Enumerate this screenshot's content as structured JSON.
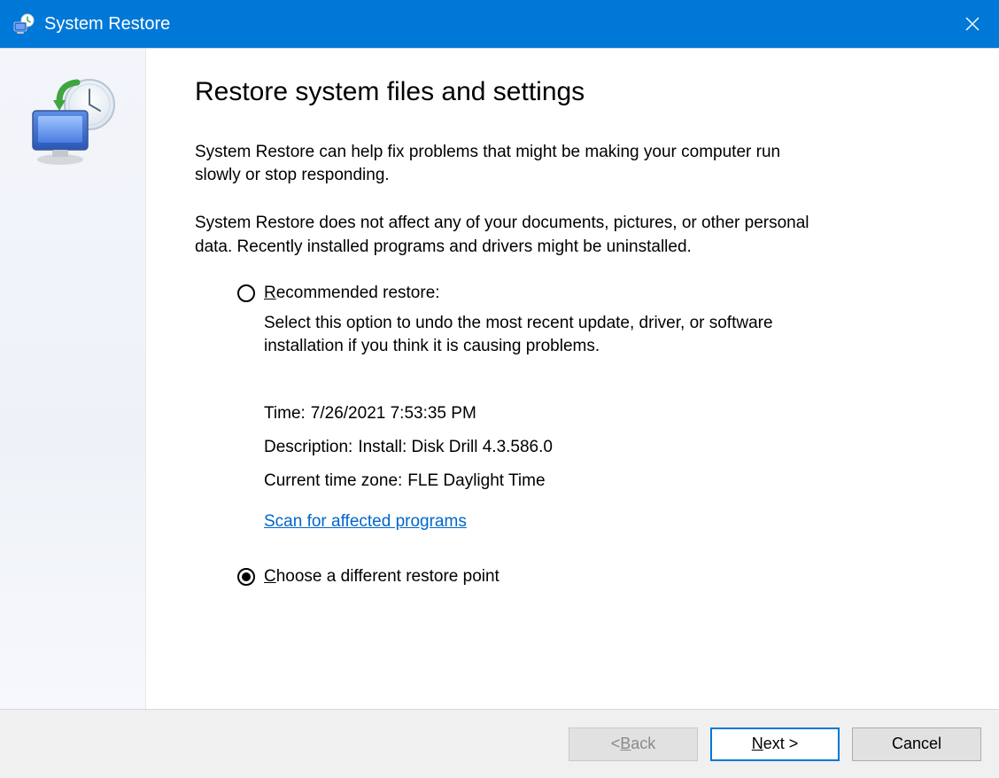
{
  "window": {
    "title": "System Restore"
  },
  "main": {
    "heading": "Restore system files and settings",
    "paragraph1": "System Restore can help fix problems that might be making your computer run slowly or stop responding.",
    "paragraph2": "System Restore does not affect any of your documents, pictures, or other personal data. Recently installed programs and drivers might be uninstalled."
  },
  "options": {
    "recommended": {
      "label_prefix": "R",
      "label_rest": "ecommended restore:",
      "description": "Select this option to undo the most recent update, driver, or software installation if you think it is causing problems.",
      "time_label": "Time:",
      "time_value": "7/26/2021 7:53:35 PM",
      "description_label": "Description:",
      "description_value": "Install: Disk Drill 4.3.586.0",
      "timezone_label": "Current time zone:",
      "timezone_value": "FLE Daylight Time",
      "scan_link": "Scan for affected programs"
    },
    "choose": {
      "label_prefix": "C",
      "label_rest": "hoose a different restore point"
    }
  },
  "footer": {
    "back_prefix": "< ",
    "back_u": "B",
    "back_rest": "ack",
    "next_u": "N",
    "next_rest": "ext >",
    "cancel": "Cancel"
  }
}
